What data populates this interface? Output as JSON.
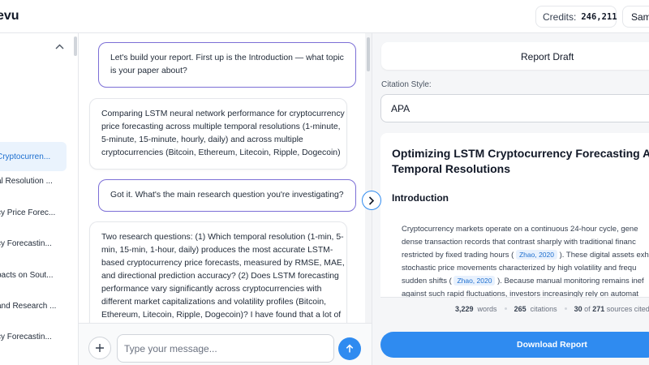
{
  "app": {
    "brand": "evu"
  },
  "header": {
    "credits_label": "Credits:",
    "credits_value": "246,211",
    "user_label": "Samu"
  },
  "sidebar": {
    "items": [
      {
        "label": "Cryptocurren...",
        "active": true
      },
      {
        "label": "al Resolution ...",
        "active": false
      },
      {
        "label": "cy Price Forec...",
        "active": false
      },
      {
        "label": "cy Forecastin...",
        "active": false
      },
      {
        "label": "pacts on Sout...",
        "active": false
      },
      {
        "label": "and Research ...",
        "active": false
      },
      {
        "label": "cy Forecastin...",
        "active": false
      }
    ]
  },
  "chat": {
    "messages": [
      {
        "role": "ai",
        "lines": [
          "Let's build your report. First up is the Introduction — what topic",
          "is your paper about?"
        ]
      },
      {
        "role": "user",
        "lines": [
          "Comparing LSTM neural network performance for cryptocurrency",
          "price forecasting across multiple temporal resolutions (1-minute,",
          "5-minute, 15-minute, hourly, daily) and across multiple",
          "cryptocurrencies (Bitcoin, Ethereum, Litecoin, Ripple, Dogecoin)"
        ]
      },
      {
        "role": "ai",
        "lines": [
          "Got it. What's the main research question you're investigating?"
        ]
      },
      {
        "role": "user",
        "lines": [
          "Two research questions: (1) Which temporal resolution (1-min, 5-",
          "min, 15-min, 1-hour, daily) produces the most accurate LSTM-",
          "based cryptocurrency price forecasts, measured by RMSE, MAE,",
          "and directional prediction accuracy? (2) Does LSTM forecasting",
          "performance vary significantly across cryptocurrencies with",
          "different market capitalizations and volatility profiles (Bitcoin,",
          "Ethereum, Litecoin, Ripple, Dogecoin)? I have found that a lot of"
        ]
      }
    ],
    "input_placeholder": "Type your message..."
  },
  "report": {
    "title": "Report Draft",
    "citation_style_label": "Citation Style:",
    "citation_style_value": "APA",
    "doc_title_line1": "Optimizing LSTM Cryptocurrency Forecasting A",
    "doc_title_line2": "Temporal Resolutions",
    "section": "Introduction",
    "body": {
      "l1": "Cryptocurrency markets operate on a continuous 24-hour cycle, gene",
      "l2": "dense transaction records that contrast sharply with traditional financ",
      "l3_pre": "restricted by fixed trading hours (",
      "cite1": "Zhao, 2020",
      "l3_post": "). These digital assets exh",
      "l4": "stochastic price movements characterized by high volatility and frequ",
      "l5_pre": "sudden shifts (",
      "cite2": "Zhao, 2020",
      "l5_post": "). Because manual monitoring remains inef",
      "l6": "against such rapid fluctuations, investors increasingly rely on automat"
    },
    "stats": {
      "words_value": "3,229",
      "words_label": "words",
      "citations_value": "265",
      "citations_label": "citations",
      "sources_cited": "30",
      "sources_of": "of",
      "sources_total": "271",
      "sources_label": "sources cited"
    },
    "download_label": "Download Report"
  },
  "colors": {
    "accent": "#2f8bf0",
    "ai_bubble_border": "#7c6fd6",
    "active_item_bg": "#eaf3fd"
  },
  "icons": {
    "collapse": "chevron-up-icon",
    "plus": "plus-icon",
    "send": "arrow-up-icon",
    "expand": "chevron-right-icon"
  }
}
